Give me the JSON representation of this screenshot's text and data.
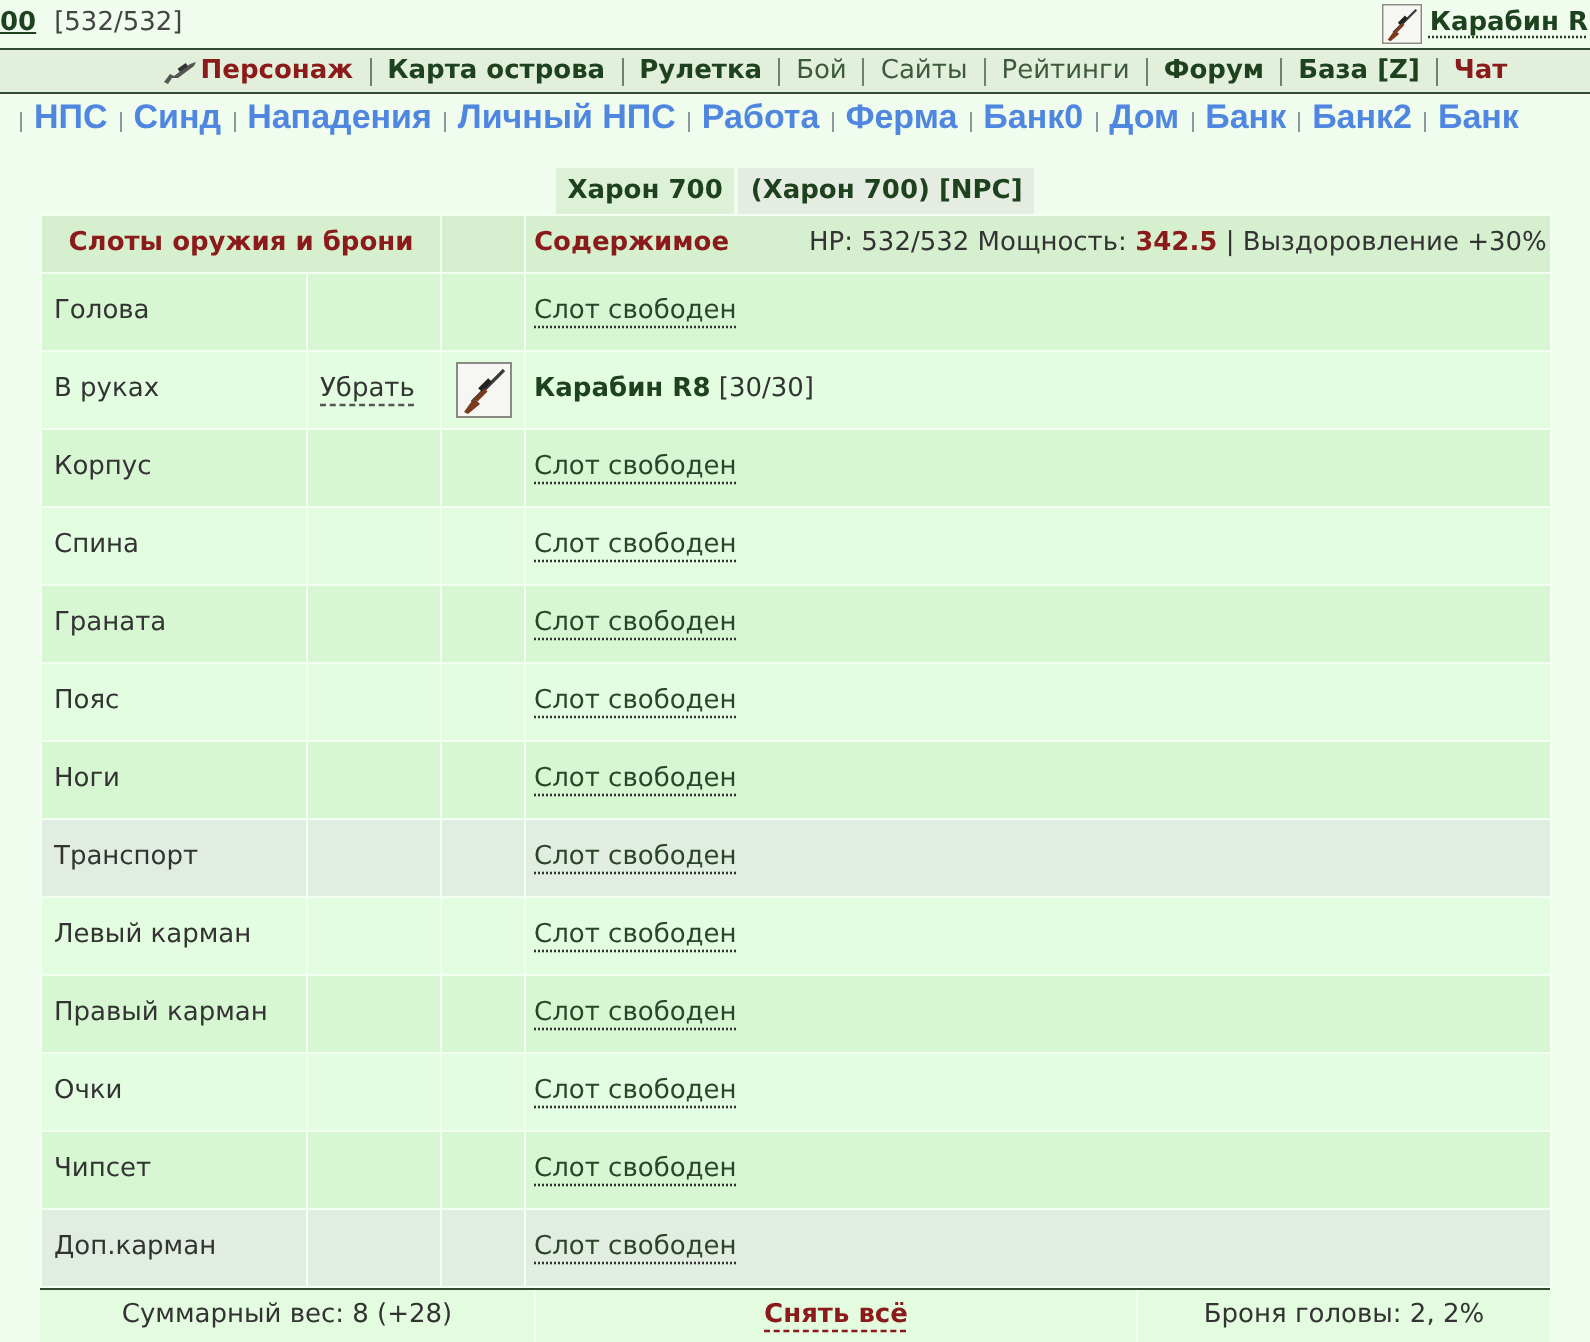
{
  "top_bar": {
    "character": "00",
    "hp": "[532/532]",
    "weapon": "Карабин R"
  },
  "main_nav": [
    {
      "label": "Персонаж",
      "kind": "current"
    },
    {
      "label": "Карта острова",
      "kind": "bold"
    },
    {
      "label": "Рулетка",
      "kind": "bold"
    },
    {
      "label": "Бой",
      "kind": "plain"
    },
    {
      "label": "Сайты",
      "kind": "plain"
    },
    {
      "label": "Рейтинги",
      "kind": "plain"
    },
    {
      "label": "Форум",
      "kind": "bold"
    },
    {
      "label": "База [Z]",
      "kind": "bold"
    },
    {
      "label": "Чат",
      "kind": "alert"
    }
  ],
  "sub_nav": [
    "НПС",
    "Синд",
    "Нападения",
    "Личный НПС",
    "Работа",
    "Ферма",
    "Банк0",
    "Дом",
    "Банк",
    "Банк2",
    "Банк"
  ],
  "tabs": [
    {
      "label": "Харон 700",
      "selected": true
    },
    {
      "label": "(Харон 700) [NPC]",
      "selected": false
    }
  ],
  "slots_table": {
    "header": {
      "slots": "Слоты оружия и брони",
      "content": "Содержимое",
      "stats": "HP: 532/532 Мощность: **342.5** | Выздоровление +30%"
    },
    "rows": [
      {
        "slot": "Голова",
        "kind": "empty",
        "content": "Слот свободен",
        "color": "#d7f6d2"
      },
      {
        "slot": "В руках",
        "kind": "item",
        "action": "Убрать",
        "content": "**Карабин R8** [30/30]",
        "color": "#e3fde0"
      },
      {
        "slot": "Корпус",
        "kind": "empty",
        "content": "Слот свободен",
        "color": "#d7f6d2"
      },
      {
        "slot": "Спина",
        "kind": "empty",
        "content": "Слот свободен",
        "color": "#e3fde0"
      },
      {
        "slot": "Граната",
        "kind": "empty",
        "content": "Слот свободен",
        "color": "#d7f6d2"
      },
      {
        "slot": "Пояс",
        "kind": "empty",
        "content": "Слот свободен",
        "color": "#e3fde0"
      },
      {
        "slot": "Ноги",
        "kind": "empty",
        "content": "Слот свободен",
        "color": "#d7f6d2"
      },
      {
        "slot": "Транспорт",
        "kind": "empty",
        "content": "Слот свободен",
        "color": "#e2ede1"
      },
      {
        "slot": "Левый карман",
        "kind": "empty",
        "content": "Слот свободен",
        "color": "#e3fde0"
      },
      {
        "slot": "Правый карман",
        "kind": "empty",
        "content": "Слот свободен",
        "color": "#d7f6d2"
      },
      {
        "slot": "Очки",
        "kind": "empty",
        "content": "Слот свободен",
        "color": "#e3fde0"
      },
      {
        "slot": "Чипсет",
        "kind": "empty",
        "content": "Слот свободен",
        "color": "#d7f6d2"
      },
      {
        "slot": "Доп.карман",
        "kind": "empty",
        "content": "Слот свободен",
        "color": "#e2ede1"
      }
    ]
  },
  "footer": {
    "weight": "Суммарный вес: 8 (+28)",
    "remove_all": "Снять всё",
    "head_armor": "Броня головы: 2, 2%"
  }
}
